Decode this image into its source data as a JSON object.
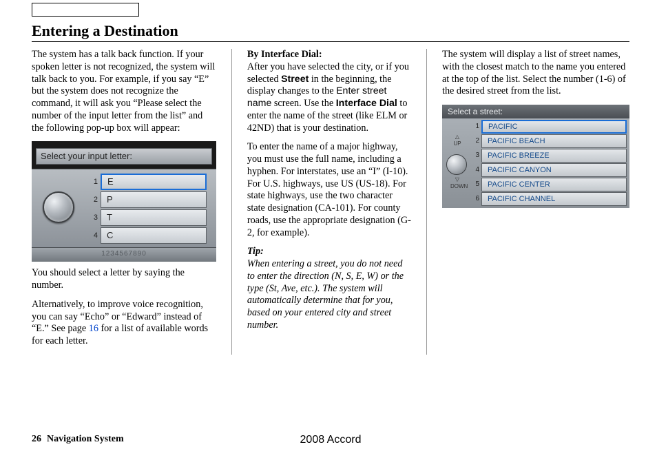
{
  "title": "Entering a Destination",
  "col1": {
    "p1": "The system has a talk back function. If your spoken letter is not recognized, the system will talk back to you. For example, if you say “E” but the system does not recognize the command, it will ask you “Please select the number of the input letter from the list” and the following pop-up box will appear:",
    "p2": "You should select a letter by saying the number.",
    "p3a": "Alternatively, to improve voice recognition, you can say “Echo” or “Edward” instead of “E.” See page ",
    "p3link": "16",
    "p3b": " for a list of available words for each letter."
  },
  "shot1": {
    "header": "Select your input letter:",
    "rows": [
      {
        "n": "1",
        "v": "E"
      },
      {
        "n": "2",
        "v": "P"
      },
      {
        "n": "3",
        "v": "T"
      },
      {
        "n": "4",
        "v": "C"
      }
    ],
    "strip": "1234567890"
  },
  "col2": {
    "subhead": "By Interface Dial:",
    "p1a": "After you have selected the city, or if you selected ",
    "p1b": "Street",
    "p1c": " in the beginning, the display changes to the ",
    "p1d": "Enter street name",
    "p1e": " screen. Use the ",
    "p1f": "Interface Dial",
    "p1g": " to enter the name of the street (like ELM or 42ND) that is your destination.",
    "p2": "To enter the name of a major highway, you must use the full name, including a hyphen. For interstates, use an “I” (I-10). For U.S. highways, use US (US-18). For state highways, use the two character state designation (CA-101). For county roads, use the appropriate designation (G-2, for example).",
    "tiplabel": "Tip:",
    "tip": "When entering a street, you do not need to enter the direction (N, S, E, W) or the type (St, Ave, etc.). The system will automatically determine that for you, based on your entered city and street number."
  },
  "col3": {
    "p1": "The system will display a list of street names, with the closest match to the name you entered at the top of the list. Select the number (1-6) of the desired street from the list."
  },
  "shot2": {
    "header": "Select a street:",
    "up": "UP",
    "down": "DOWN",
    "rows": [
      {
        "n": "1",
        "v": "PACIFIC"
      },
      {
        "n": "2",
        "v": "PACIFIC BEACH"
      },
      {
        "n": "3",
        "v": "PACIFIC BREEZE"
      },
      {
        "n": "4",
        "v": "PACIFIC CANYON"
      },
      {
        "n": "5",
        "v": "PACIFIC CENTER"
      },
      {
        "n": "6",
        "v": "PACIFIC CHANNEL"
      }
    ]
  },
  "footer": {
    "page": "26",
    "section": "Navigation System",
    "model": "2008  Accord"
  }
}
